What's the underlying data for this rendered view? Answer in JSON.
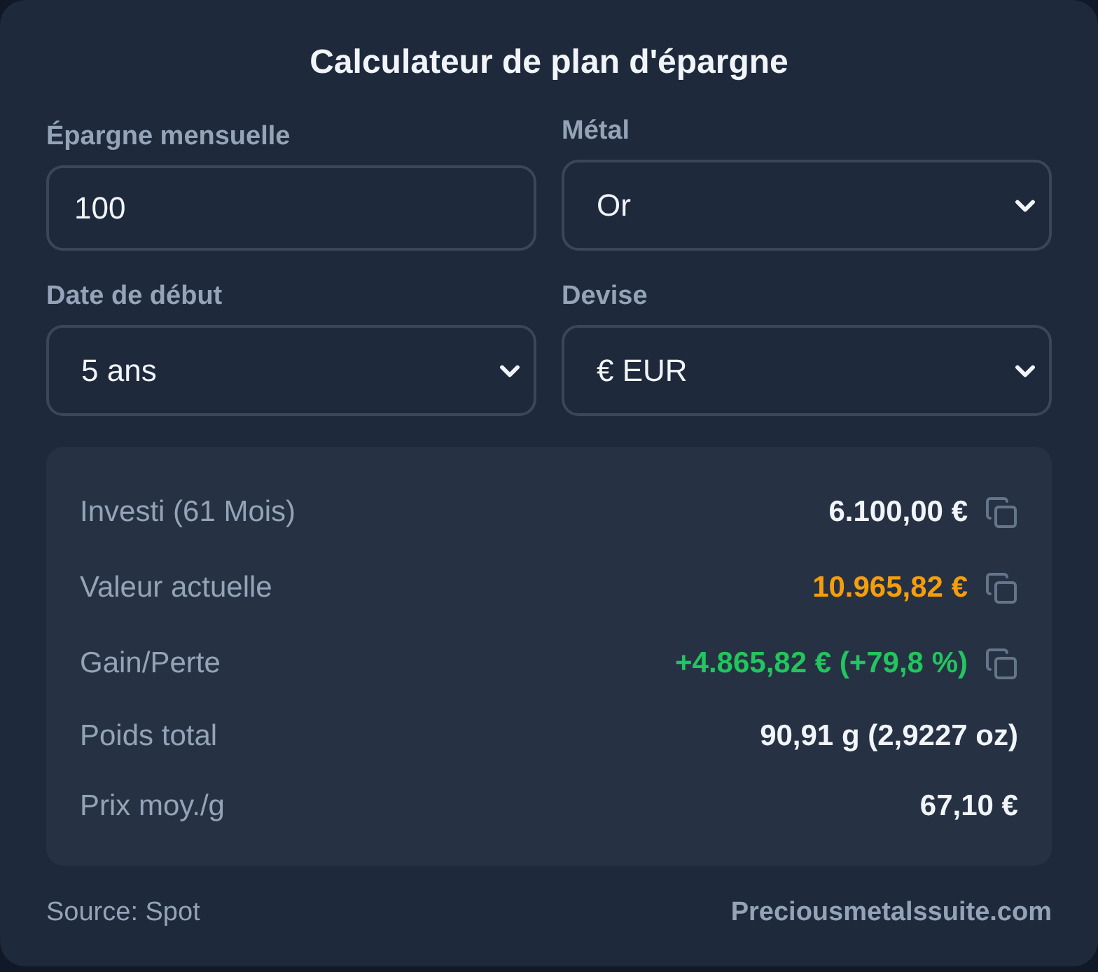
{
  "title": "Calculateur de plan d'épargne",
  "fields": [
    {
      "kind": "input",
      "label": "Épargne mensuelle",
      "value": "100"
    },
    {
      "kind": "select",
      "label": "Métal",
      "value": "Or"
    },
    {
      "kind": "select",
      "label": "Date de début",
      "value": "5 ans"
    },
    {
      "kind": "select",
      "label": "Devise",
      "value": "€ EUR"
    }
  ],
  "results": [
    {
      "label": "Investi (61 Mois)",
      "value": "6.100,00 €",
      "color": "#f1f5f9",
      "copyable": true
    },
    {
      "label": "Valeur actuelle",
      "value": "10.965,82 €",
      "color": "#f59e0b",
      "copyable": true
    },
    {
      "label": "Gain/Perte",
      "value": "+4.865,82 € (+79,8 %)",
      "color": "#22c55e",
      "copyable": true
    },
    {
      "label": "Poids total",
      "value": "90,91 g (2,9227 oz)",
      "color": "#f1f5f9",
      "copyable": false
    },
    {
      "label": "Prix moy./g",
      "value": "67,10 €",
      "color": "#f1f5f9",
      "copyable": false
    }
  ],
  "footer": {
    "source": "Source: Spot",
    "link": "Preciousmetalssuite.com"
  }
}
